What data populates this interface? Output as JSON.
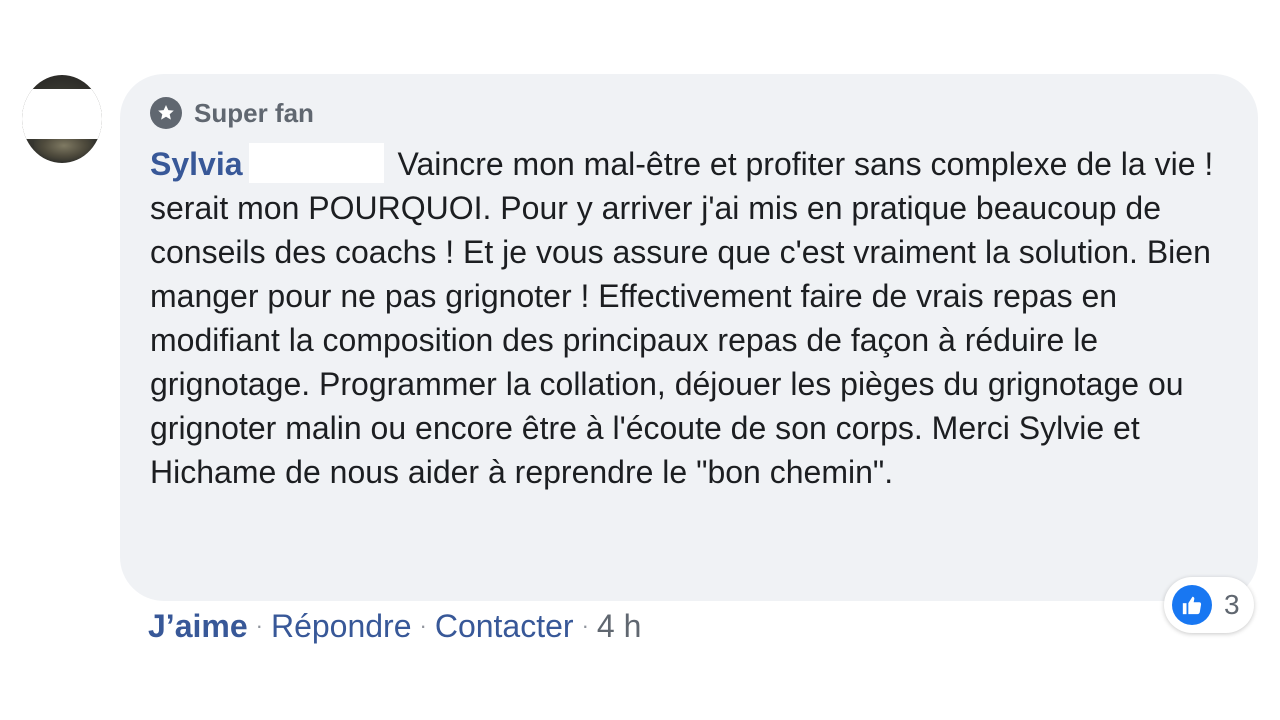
{
  "comment": {
    "badge": {
      "icon": "star-icon",
      "label": "Super fan"
    },
    "author": "Sylvia",
    "text": "Vaincre mon mal-être et profiter sans complexe de la vie ! serait mon POURQUOI. Pour y arriver j'ai mis en pratique beaucoup de conseils des coachs ! Et je vous assure que c'est vraiment la solution. Bien manger pour ne pas grignoter ! Effectivement faire de vrais repas en modifiant la composition des principaux repas de façon à réduire le grignotage. Programmer la collation, déjouer les pièges du grignotage ou grignoter malin ou encore être à l'écoute de son corps. Merci Sylvie et Hichame de nous aider à reprendre le \"bon chemin\".",
    "reactions": {
      "icon": "thumbs-up-icon",
      "count": "3"
    },
    "actions": {
      "like": "J’aime",
      "reply": "Répondre",
      "contact": "Contacter",
      "separator": "·",
      "time": "4 h"
    }
  },
  "colors": {
    "bubble": "#f0f2f5",
    "author": "#385898",
    "link": "#385898",
    "like_blue": "#1877f2",
    "muted": "#606770"
  }
}
